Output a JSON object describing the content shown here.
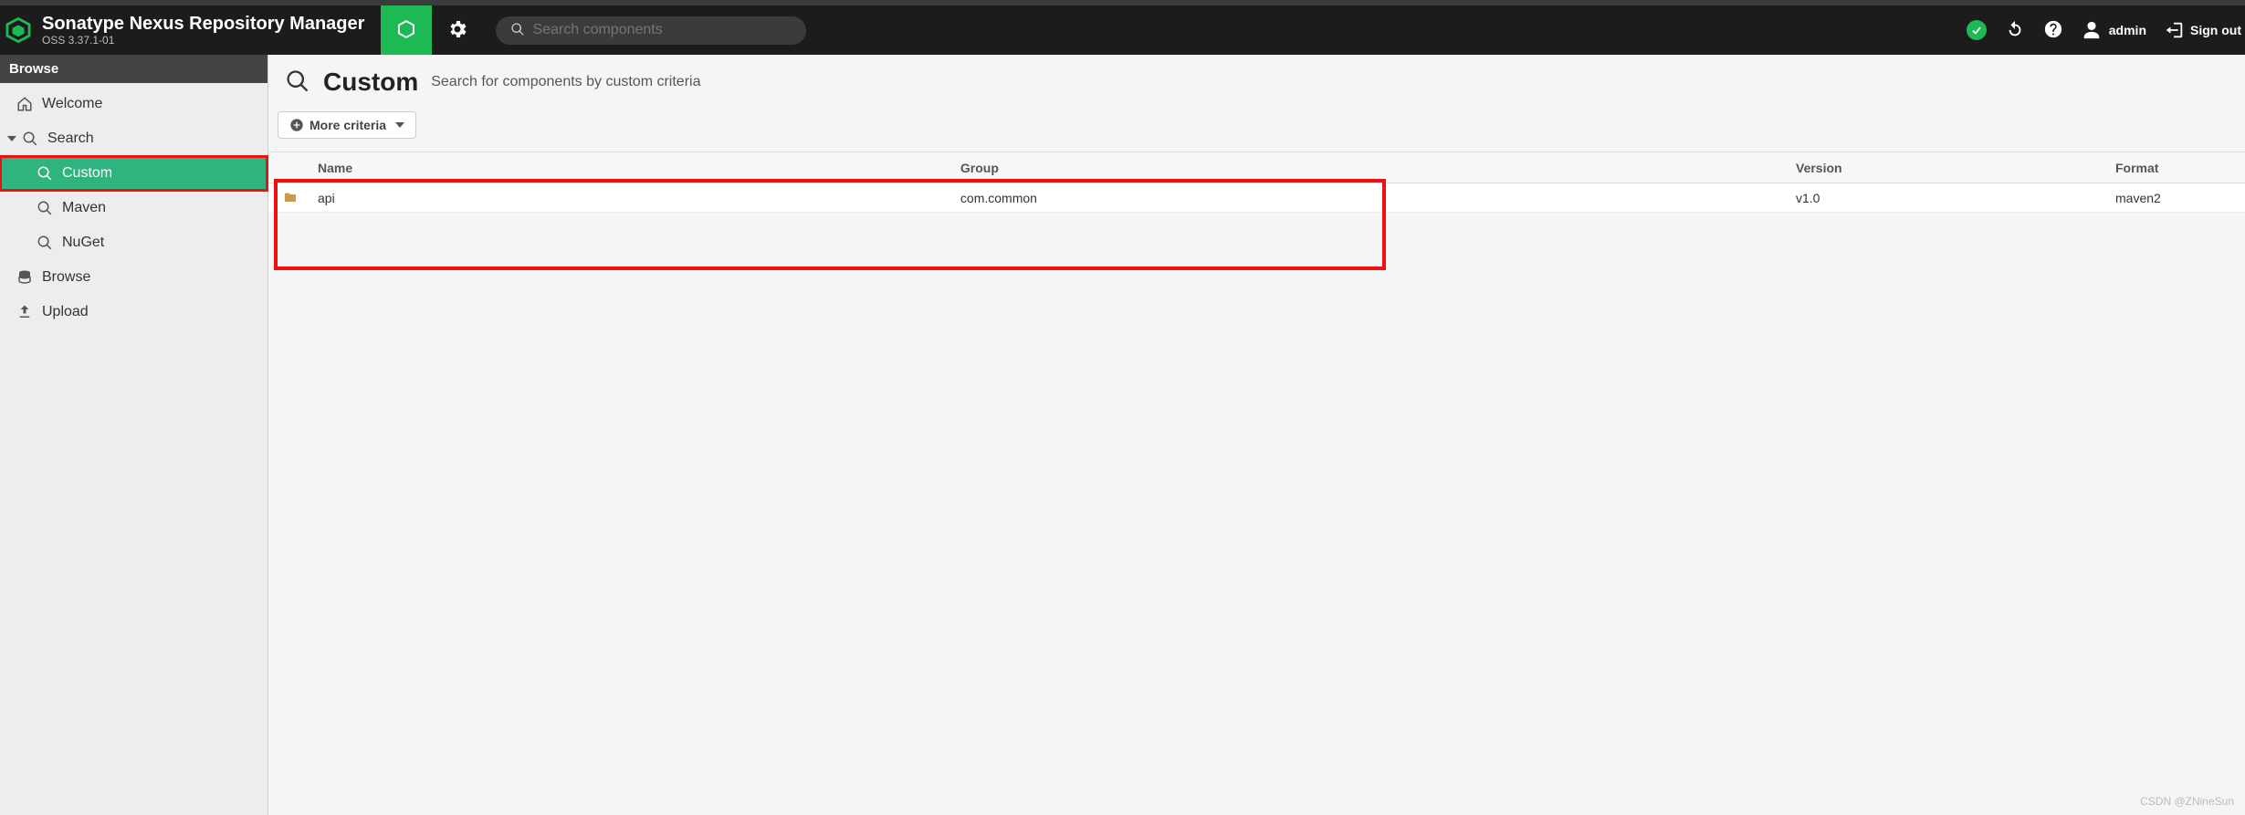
{
  "header": {
    "title": "Sonatype Nexus Repository Manager",
    "subtitle": "OSS 3.37.1-01",
    "search_placeholder": "Search components",
    "username": "admin",
    "signout_label": "Sign out"
  },
  "sidebar": {
    "heading": "Browse",
    "items": [
      {
        "label": "Welcome",
        "icon": "home"
      },
      {
        "label": "Search",
        "icon": "search",
        "expanded": true,
        "children": [
          {
            "label": "Custom",
            "icon": "search",
            "active": true
          },
          {
            "label": "Maven",
            "icon": "search"
          },
          {
            "label": "NuGet",
            "icon": "search"
          }
        ]
      },
      {
        "label": "Browse",
        "icon": "db"
      },
      {
        "label": "Upload",
        "icon": "upload"
      }
    ]
  },
  "page": {
    "title": "Custom",
    "subtitle": "Search for components by custom criteria",
    "more_criteria_label": "More criteria"
  },
  "table": {
    "columns": [
      "Name",
      "Group",
      "Version",
      "Format"
    ],
    "rows": [
      {
        "name": "api",
        "group": "com.common",
        "version": "v1.0",
        "format": "maven2"
      }
    ]
  },
  "watermark": "CSDN @ZNineSun"
}
